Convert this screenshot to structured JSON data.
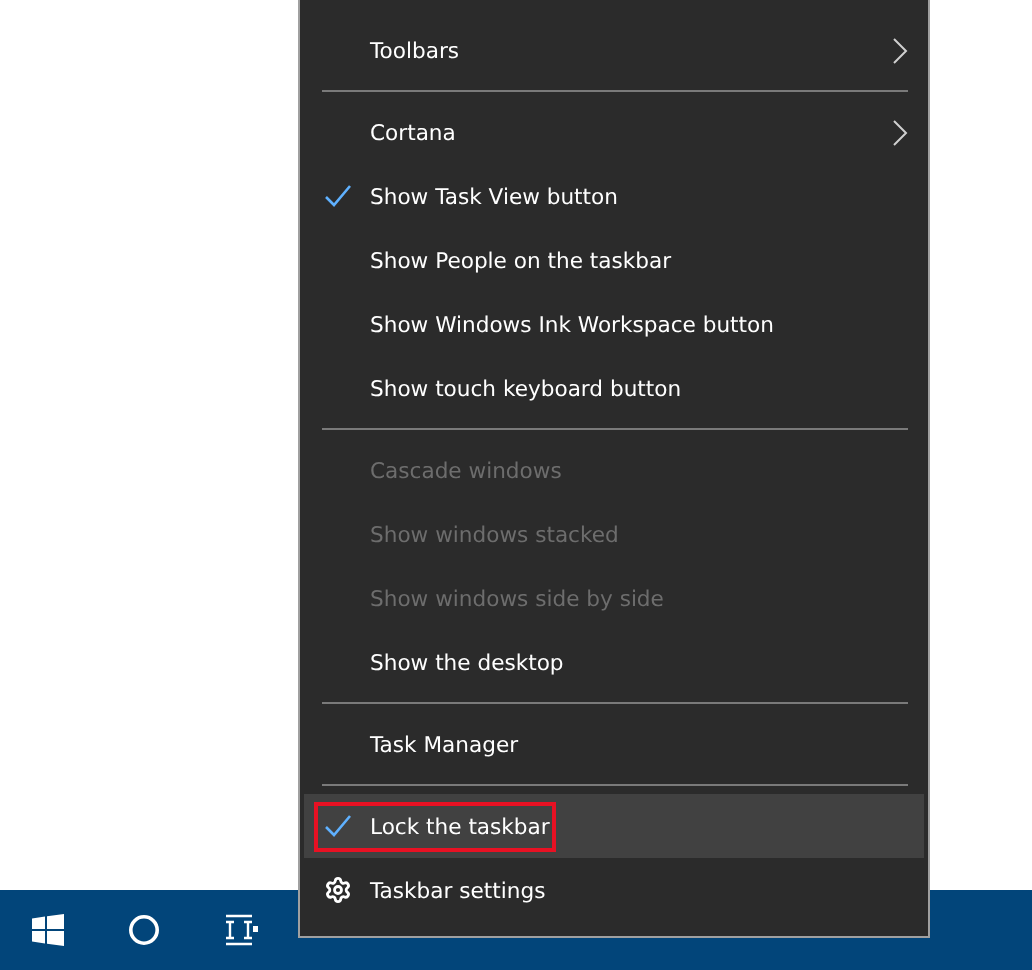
{
  "context_menu": {
    "items": [
      {
        "kind": "item",
        "label": "Toolbars",
        "submenu": true,
        "checked": false,
        "disabled": false,
        "selected": false
      },
      {
        "kind": "separator"
      },
      {
        "kind": "item",
        "label": "Cortana",
        "submenu": true,
        "checked": false,
        "disabled": false,
        "selected": false
      },
      {
        "kind": "item",
        "label": "Show Task View button",
        "submenu": false,
        "checked": true,
        "disabled": false,
        "selected": false
      },
      {
        "kind": "item",
        "label": "Show People on the taskbar",
        "submenu": false,
        "checked": false,
        "disabled": false,
        "selected": false
      },
      {
        "kind": "item",
        "label": "Show Windows Ink Workspace button",
        "submenu": false,
        "checked": false,
        "disabled": false,
        "selected": false
      },
      {
        "kind": "item",
        "label": "Show touch keyboard button",
        "submenu": false,
        "checked": false,
        "disabled": false,
        "selected": false
      },
      {
        "kind": "separator"
      },
      {
        "kind": "item",
        "label": "Cascade windows",
        "submenu": false,
        "checked": false,
        "disabled": true,
        "selected": false
      },
      {
        "kind": "item",
        "label": "Show windows stacked",
        "submenu": false,
        "checked": false,
        "disabled": true,
        "selected": false
      },
      {
        "kind": "item",
        "label": "Show windows side by side",
        "submenu": false,
        "checked": false,
        "disabled": true,
        "selected": false
      },
      {
        "kind": "item",
        "label": "Show the desktop",
        "submenu": false,
        "checked": false,
        "disabled": false,
        "selected": false
      },
      {
        "kind": "separator"
      },
      {
        "kind": "item",
        "label": "Task Manager",
        "submenu": false,
        "checked": false,
        "disabled": false,
        "selected": false
      },
      {
        "kind": "separator"
      },
      {
        "kind": "item",
        "label": "Lock the taskbar",
        "submenu": false,
        "checked": true,
        "disabled": false,
        "selected": true,
        "annotated": true
      },
      {
        "kind": "settings",
        "label": "Taskbar settings",
        "submenu": false,
        "checked": false,
        "disabled": false,
        "selected": false
      }
    ]
  }
}
